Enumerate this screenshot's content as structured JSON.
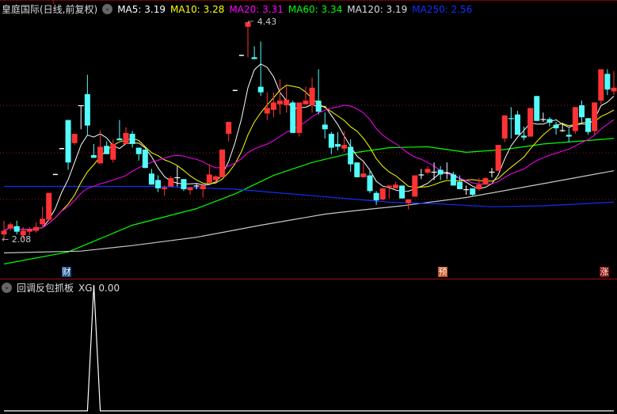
{
  "header": {
    "title": "皇庭国际(日线,前复权)",
    "ma": [
      {
        "label": "MA5: 3.19",
        "color": "#ffffff"
      },
      {
        "label": "MA10: 3.28",
        "color": "#ffff00"
      },
      {
        "label": "MA20: 3.31",
        "color": "#ff00ff"
      },
      {
        "label": "MA60: 3.34",
        "color": "#00ff00"
      },
      {
        "label": "MA120: 3.19",
        "color": "#d0d0d0"
      },
      {
        "label": "MA250: 2.56",
        "color": "#0000ff"
      }
    ]
  },
  "markers": {
    "cai": "财",
    "yu": "预",
    "zhang": "涨"
  },
  "indicator": {
    "name": "回调反包抓板",
    "value_label": "XG: 0.00"
  },
  "chart_data": [
    {
      "type": "candlestick",
      "title": "皇庭国际 日线 前复权",
      "high_label": "4.43",
      "low_label": "2.08",
      "ylim": [
        2.0,
        4.5
      ],
      "colors": {
        "up": "#ff3333",
        "down": "#54fcfc",
        "flat": "#ffffff"
      },
      "ohlc_fields": [
        "open",
        "close",
        "high",
        "low"
      ],
      "candles": [
        [
          2.13,
          2.17,
          2.28,
          2.08
        ],
        [
          2.2,
          2.24,
          2.26,
          2.17
        ],
        [
          2.22,
          2.16,
          2.28,
          2.13
        ],
        [
          2.12,
          2.17,
          2.21,
          2.08
        ],
        [
          2.16,
          2.18,
          2.21,
          2.12
        ],
        [
          2.17,
          2.21,
          2.26,
          2.15
        ],
        [
          2.24,
          2.3,
          2.43,
          2.22
        ],
        [
          2.29,
          2.58,
          2.58,
          2.28
        ],
        [
          2.78,
          2.78,
          2.78,
          2.78
        ],
        [
          3.06,
          3.06,
          3.06,
          3.06
        ],
        [
          3.37,
          2.91,
          3.37,
          2.83
        ],
        [
          3.12,
          3.22,
          3.22,
          3.1
        ],
        [
          3.53,
          3.53,
          3.53,
          3.27
        ],
        [
          3.65,
          3.31,
          3.86,
          3.2
        ],
        [
          2.99,
          2.96,
          3.11,
          2.96
        ],
        [
          2.9,
          3.08,
          3.26,
          2.9
        ],
        [
          3.09,
          3.0,
          3.14,
          3.0
        ],
        [
          2.94,
          3.11,
          3.16,
          2.91
        ],
        [
          3.17,
          3.15,
          3.37,
          3.15
        ],
        [
          3.11,
          3.23,
          3.29,
          3.11
        ],
        [
          3.22,
          3.11,
          3.25,
          3.07
        ],
        [
          3.07,
          3.0,
          3.07,
          2.93
        ],
        [
          3.05,
          2.85,
          3.05,
          2.85
        ],
        [
          2.79,
          2.67,
          2.84,
          2.67
        ],
        [
          2.72,
          2.63,
          2.77,
          2.59
        ],
        [
          2.62,
          2.64,
          2.66,
          2.55
        ],
        [
          2.65,
          2.74,
          2.76,
          2.65
        ],
        [
          2.75,
          2.75,
          2.87,
          2.65
        ],
        [
          2.73,
          2.62,
          2.73,
          2.6
        ],
        [
          2.61,
          2.64,
          2.64,
          2.56
        ],
        [
          2.66,
          2.66,
          2.68,
          2.62
        ],
        [
          2.62,
          2.66,
          2.68,
          2.53
        ],
        [
          2.69,
          2.78,
          2.89,
          2.69
        ],
        [
          2.72,
          2.76,
          2.77,
          2.7
        ],
        [
          2.75,
          3.05,
          3.05,
          2.75
        ],
        [
          3.22,
          3.35,
          3.35,
          3.14
        ],
        [
          3.69,
          3.69,
          3.69,
          3.69
        ],
        [
          4.07,
          4.07,
          4.07,
          4.07
        ],
        [
          4.38,
          4.43,
          4.43,
          4.05
        ],
        [
          4.05,
          4.03,
          4.17,
          4.03
        ],
        [
          3.73,
          3.67,
          4.22,
          3.63
        ],
        [
          3.44,
          3.5,
          3.67,
          3.37
        ],
        [
          3.48,
          3.56,
          3.67,
          3.4
        ],
        [
          3.54,
          3.58,
          3.81,
          3.43
        ],
        [
          3.53,
          3.59,
          3.74,
          3.45
        ],
        [
          3.56,
          3.23,
          3.58,
          3.23
        ],
        [
          3.23,
          3.56,
          3.56,
          3.19
        ],
        [
          3.54,
          3.58,
          3.73,
          3.54
        ],
        [
          3.53,
          3.72,
          3.83,
          3.45
        ],
        [
          3.58,
          3.46,
          3.92,
          3.43
        ],
        [
          3.32,
          3.27,
          3.45,
          3.17
        ],
        [
          3.22,
          3.07,
          3.24,
          3.0
        ],
        [
          3.11,
          3.08,
          3.24,
          3.04
        ],
        [
          3.06,
          3.1,
          3.25,
          3.02
        ],
        [
          3.08,
          2.89,
          3.16,
          2.81
        ],
        [
          2.91,
          2.75,
          2.91,
          2.75
        ],
        [
          2.75,
          2.79,
          2.91,
          2.75
        ],
        [
          2.77,
          2.6,
          2.83,
          2.58
        ],
        [
          2.58,
          2.5,
          2.6,
          2.45
        ],
        [
          2.51,
          2.63,
          2.63,
          2.5
        ],
        [
          2.64,
          2.66,
          2.66,
          2.52
        ],
        [
          2.63,
          2.67,
          2.7,
          2.63
        ],
        [
          2.66,
          2.52,
          2.66,
          2.52
        ],
        [
          2.47,
          2.51,
          2.51,
          2.4
        ],
        [
          2.54,
          2.77,
          2.77,
          2.54
        ],
        [
          2.78,
          2.78,
          2.84,
          2.73
        ],
        [
          2.8,
          2.84,
          2.87,
          2.78
        ],
        [
          2.81,
          2.81,
          2.91,
          2.72
        ],
        [
          2.83,
          2.78,
          2.87,
          2.72
        ],
        [
          2.8,
          2.8,
          2.91,
          2.73
        ],
        [
          2.78,
          2.66,
          2.81,
          2.66
        ],
        [
          2.7,
          2.62,
          2.77,
          2.62
        ],
        [
          2.62,
          2.62,
          2.66,
          2.56
        ],
        [
          2.63,
          2.56,
          2.63,
          2.55
        ],
        [
          2.62,
          2.67,
          2.74,
          2.6
        ],
        [
          2.67,
          2.74,
          2.75,
          2.67
        ],
        [
          2.81,
          2.81,
          2.85,
          2.75
        ],
        [
          2.82,
          3.1,
          3.1,
          2.82
        ],
        [
          3.17,
          3.42,
          3.42,
          3.13
        ],
        [
          3.39,
          3.38,
          3.51,
          3.17
        ],
        [
          3.43,
          3.21,
          3.47,
          3.21
        ],
        [
          3.2,
          3.18,
          3.3,
          3.15
        ],
        [
          3.19,
          3.5,
          3.5,
          3.19
        ],
        [
          3.63,
          3.36,
          3.63,
          3.36
        ],
        [
          3.38,
          3.38,
          3.45,
          3.35
        ],
        [
          3.38,
          3.34,
          3.4,
          3.3
        ],
        [
          3.32,
          3.28,
          3.35,
          3.21
        ],
        [
          3.26,
          3.26,
          3.34,
          3.24
        ],
        [
          3.21,
          3.19,
          3.28,
          3.13
        ],
        [
          3.25,
          3.51,
          3.51,
          3.22
        ],
        [
          3.53,
          3.4,
          3.58,
          3.34
        ],
        [
          3.39,
          3.24,
          3.39,
          3.21
        ],
        [
          3.25,
          3.56,
          3.56,
          3.21
        ],
        [
          3.58,
          3.92,
          3.92,
          3.54
        ],
        [
          3.87,
          3.7,
          3.92,
          3.64
        ],
        [
          3.68,
          3.72,
          3.9,
          3.64
        ]
      ],
      "moving_averages": {
        "computed_periods": [
          {
            "name": "MA5",
            "period": 5,
            "color": "#ffffff"
          },
          {
            "name": "MA10",
            "period": 10,
            "color": "#ffff00"
          },
          {
            "name": "MA20",
            "period": 20,
            "color": "#ff00ff"
          }
        ],
        "sampled": [
          {
            "name": "MA60",
            "color": "#00ff00",
            "index": [
              0,
              10,
              20,
              30,
              36,
              42,
              48,
              54,
              60,
              66,
              72,
              78,
              84,
              95
            ],
            "values": [
              1.81,
              1.94,
              2.23,
              2.41,
              2.57,
              2.77,
              2.91,
              3.01,
              3.07,
              3.08,
              3.02,
              3.05,
              3.11,
              3.17
            ]
          },
          {
            "name": "MA120",
            "color": "#c8c8c8",
            "index": [
              0,
              12,
              20,
              30,
              40,
              50,
              55,
              62,
              72,
              84,
              95
            ],
            "values": [
              1.93,
              1.95,
              2.01,
              2.1,
              2.23,
              2.35,
              2.39,
              2.44,
              2.53,
              2.68,
              2.82
            ]
          },
          {
            "name": "MA250",
            "color": "#1030ff",
            "index": [
              0,
              12,
              24,
              36,
              48,
              60,
              68,
              76,
              84,
              95
            ],
            "values": [
              2.65,
              2.65,
              2.65,
              2.62,
              2.55,
              2.48,
              2.46,
              2.43,
              2.44,
              2.48
            ]
          }
        ]
      },
      "event_markers": [
        {
          "label": "财",
          "index": 9,
          "color": "#1a4f8a"
        },
        {
          "label": "预",
          "index": 68,
          "color": "#c0501a"
        },
        {
          "label": "涨",
          "index": 93,
          "color": "#8a0a0a"
        }
      ]
    },
    {
      "type": "line",
      "title": "回调反包抓板",
      "series": [
        {
          "name": "XG",
          "signal_index": [
            14
          ],
          "signal_value": 1
        }
      ],
      "ylim": [
        0,
        1
      ]
    }
  ]
}
